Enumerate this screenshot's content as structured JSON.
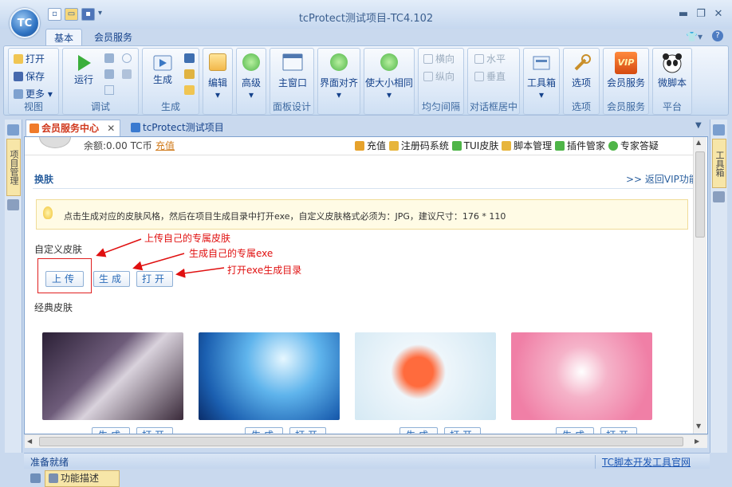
{
  "window": {
    "title": "tcProtect测试项目-TC4.102",
    "app_button": "TC"
  },
  "ribbon_tabs": [
    "基本",
    "会员服务"
  ],
  "ribbon": {
    "view": {
      "open": "打开",
      "save": "保存",
      "more": "更多",
      "label": "视图"
    },
    "debug": {
      "run": "运行",
      "label": "调试"
    },
    "generate": {
      "gen": "生成",
      "label": "生成"
    },
    "edit": {
      "edit": "编辑"
    },
    "advanced": {
      "adv": "高级"
    },
    "panel": {
      "main_window": "主窗口",
      "label": "面板设计"
    },
    "align": {
      "interface_align": "界面对齐"
    },
    "size": {
      "same_size": "使大小相同"
    },
    "spacing": {
      "horizontal": "横向",
      "vertical": "纵向",
      "label": "均匀间隔"
    },
    "center": {
      "horizontal": "水平",
      "vertical": "垂直",
      "label": "对话框居中"
    },
    "toolbox": {
      "label": "工具箱"
    },
    "options": {
      "btn": "选项",
      "label": "选项"
    },
    "member": {
      "btn": "会员服务",
      "label": "会员服务",
      "vip": "VIP"
    },
    "platform": {
      "btn": "微脚本",
      "label": "平台"
    }
  },
  "doc_tabs": [
    "会员服务中心",
    "tcProtect测试项目"
  ],
  "side": {
    "left_tab": "项目管理",
    "right_tab": "工具箱"
  },
  "content": {
    "balance": "余额:0.00 TC币",
    "recharge_link": "充值",
    "top_links": [
      "充值",
      "注册码系统",
      "TUI皮肤",
      "脚本管理",
      "插件管家",
      "专家答疑"
    ],
    "section_title": "换肤",
    "back_link": ">> 返回VIP功能",
    "notice": "点击生成对应的皮肤风格，然后在项目生成目录中打开exe，自定义皮肤格式必须为：JPG，建议尺寸：176 * 110",
    "custom_label": "自定义皮肤",
    "buttons": {
      "upload": "上传",
      "generate": "生成",
      "open": "打开"
    },
    "annotations": [
      "上传自己的专属皮肤",
      "生成自己的专属exe",
      "打开exe生成目录"
    ],
    "classic_label": "经典皮肤",
    "classic_buttons": {
      "generate": "生成",
      "open": "打开"
    }
  },
  "status": {
    "left": "准备就绪",
    "right_link": "TC脚本开发工具官网"
  },
  "bottom": {
    "tab": "功能描述"
  }
}
